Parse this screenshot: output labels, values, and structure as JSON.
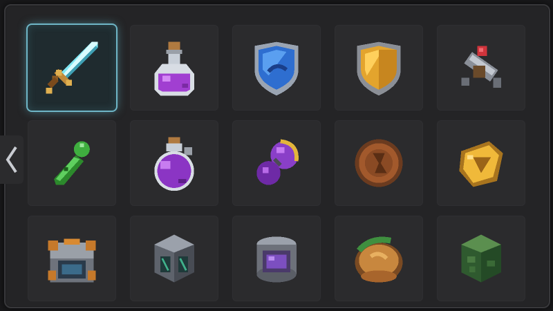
{
  "inventory": {
    "selected_index": 0,
    "nav": {
      "prev_icon": "chevron-left-icon"
    },
    "slots": [
      {
        "item": "sword-icon"
      },
      {
        "item": "purple-potion-bottle-icon"
      },
      {
        "item": "blue-shield-icon"
      },
      {
        "item": "gold-shield-icon"
      },
      {
        "item": "pickaxe-hammer-icon"
      },
      {
        "item": "green-gem-pod-icon"
      },
      {
        "item": "round-purple-potion-icon"
      },
      {
        "item": "purple-crystal-ring-icon"
      },
      {
        "item": "bronze-coin-icon"
      },
      {
        "item": "gold-badge-icon"
      },
      {
        "item": "treasure-chest-icon"
      },
      {
        "item": "iron-crate-icon"
      },
      {
        "item": "crystal-canister-icon"
      },
      {
        "item": "bread-loaf-icon"
      },
      {
        "item": "green-stone-block-icon"
      }
    ]
  },
  "colors": {
    "panel": "#242426",
    "slot": "#2b2b2d",
    "selected_glow": "#6fb6c7"
  }
}
